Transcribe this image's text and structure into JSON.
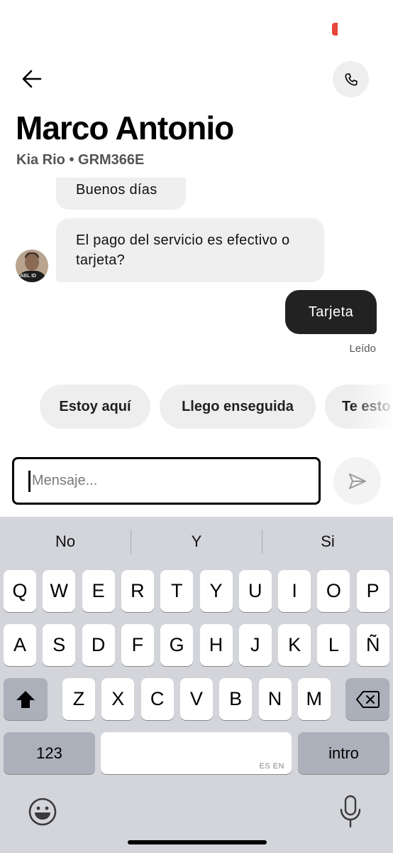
{
  "header": {
    "driver_name": "Marco Antonio",
    "vehicle": "Kia Rio • GRM366E",
    "icons": {
      "back": "arrow-left-icon",
      "call": "phone-icon"
    }
  },
  "messages": [
    {
      "from": "driver",
      "text": "Buenos días"
    },
    {
      "from": "driver",
      "text": "El pago del servicio es efectivo o tarjeta?"
    },
    {
      "from": "me",
      "text": "Tarjeta",
      "status": "Leído"
    }
  ],
  "avatar": {
    "shirt_text": "ABL ID"
  },
  "quick_replies": [
    "Estoy aquí",
    "Llego enseguida",
    "Te esto"
  ],
  "composer": {
    "placeholder": "Mensaje...",
    "send_icon": "send-icon"
  },
  "keyboard": {
    "suggestions": [
      "No",
      "Y",
      "Si"
    ],
    "row1": [
      "Q",
      "W",
      "E",
      "R",
      "T",
      "Y",
      "U",
      "I",
      "O",
      "P"
    ],
    "row2": [
      "A",
      "S",
      "D",
      "F",
      "G",
      "H",
      "J",
      "K",
      "L",
      "Ñ"
    ],
    "row3": [
      "Z",
      "X",
      "C",
      "V",
      "B",
      "N",
      "M"
    ],
    "numbers_key": "123",
    "space_lang": "ES EN",
    "return_key": "intro",
    "icons": {
      "shift": "shift-icon",
      "delete": "backspace-icon",
      "emoji": "emoji-icon",
      "mic": "microphone-icon"
    }
  },
  "colors": {
    "accent_status": "#e8453c",
    "outgoing_bubble": "#222222",
    "incoming_bubble": "#efefef",
    "keyboard_bg": "#d3d5da"
  }
}
